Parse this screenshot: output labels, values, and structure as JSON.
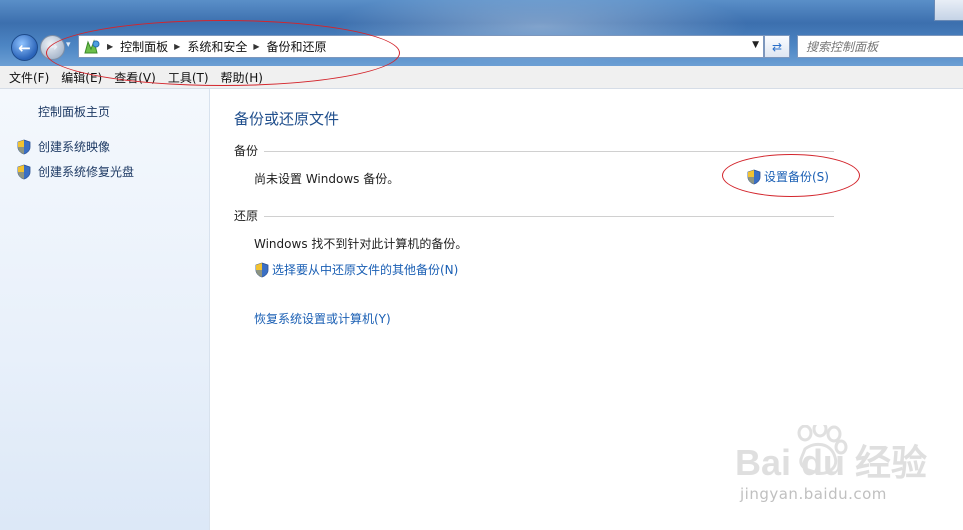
{
  "address": {
    "breadcrumbs": [
      "控制面板",
      "系统和安全",
      "备份和还原"
    ]
  },
  "search": {
    "placeholder": "搜索控制面板"
  },
  "menu": {
    "items": [
      "文件(F)",
      "编辑(E)",
      "查看(V)",
      "工具(T)",
      "帮助(H)"
    ]
  },
  "nav": {
    "home": "控制面板主页",
    "links": [
      "创建系统映像",
      "创建系统修复光盘"
    ]
  },
  "main": {
    "title": "备份或还原文件",
    "backup": {
      "heading": "备份",
      "status": "尚未设置 Windows 备份。",
      "setup_link": "设置备份(S)"
    },
    "restore": {
      "heading": "还原",
      "status": "Windows 找不到针对此计算机的备份。",
      "select_link": "选择要从中还原文件的其他备份(N)",
      "recover_link": "恢复系统设置或计算机(Y)"
    }
  },
  "watermark": {
    "brand": "Bai du 经验",
    "url": "jingyan.baidu.com"
  },
  "colors": {
    "link": "#1a5fb4",
    "title": "#1f4e8c",
    "annotation": "#d3252c"
  }
}
